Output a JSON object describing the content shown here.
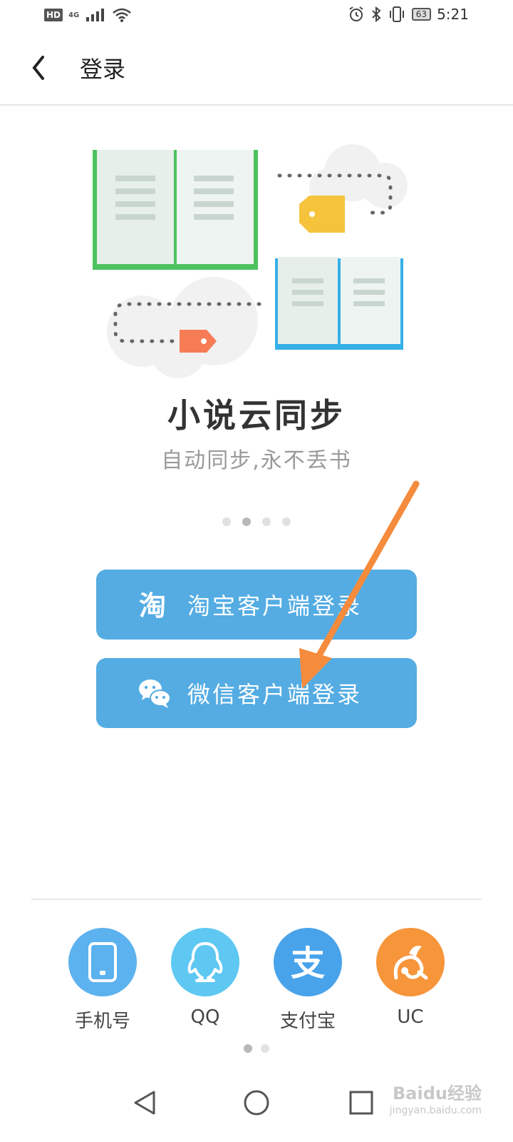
{
  "status_bar": {
    "hd": "HD",
    "network": "4G",
    "battery": "63",
    "time": "5:21"
  },
  "header": {
    "title": "登录"
  },
  "hero": {
    "headline": "小说云同步",
    "subtitle": "自动同步,永不丢书",
    "carousel_count": 4,
    "carousel_active": 1
  },
  "login_buttons": {
    "taobao_label": "淘宝客户端登录",
    "taobao_icon": "淘",
    "wechat_label": "微信客户端登录"
  },
  "alt_logins": [
    {
      "label": "手机号",
      "icon": "phone-icon",
      "color": "#5cb2ee"
    },
    {
      "label": "QQ",
      "icon": "qq-icon",
      "color": "#5ec8f2"
    },
    {
      "label": "支付宝",
      "icon": "alipay-icon",
      "color": "#49a3ea"
    },
    {
      "label": "UC",
      "icon": "uc-squirrel-icon",
      "color": "#f7953a"
    }
  ],
  "alt_icon_text": {
    "alipay": "支"
  },
  "alt_page_count": 2,
  "alt_page_active": 0,
  "watermark": {
    "text": "Baidu经验",
    "sub": "jingyan.baidu.com"
  },
  "colors": {
    "button_blue": "#54ace3",
    "annotation_arrow": "#f58b3c"
  }
}
